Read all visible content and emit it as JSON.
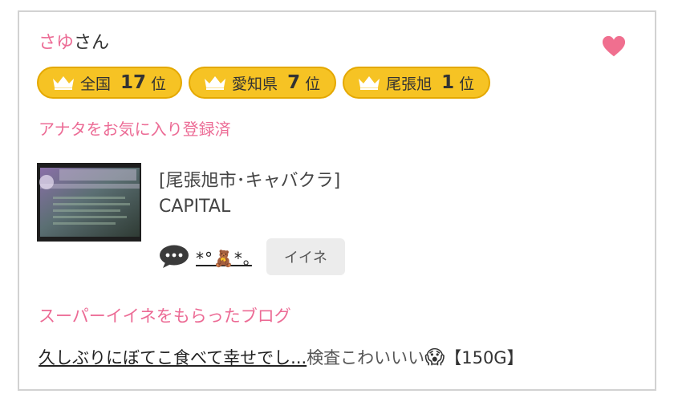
{
  "user": {
    "name_colored": "さゆ",
    "name_suffix": "さん"
  },
  "badges": [
    {
      "area": "全国",
      "rank": "17",
      "unit": "位"
    },
    {
      "area": "愛知県",
      "rank": "7",
      "unit": "位"
    },
    {
      "area": "尾張旭",
      "rank": "1",
      "unit": "位"
    }
  ],
  "favorite_note": "アナタをお気に入り登録済",
  "shop": {
    "category": "[尾張旭市･キャバクラ]",
    "name": "CAPITAL"
  },
  "comment": {
    "nickname": "*°🧸*｡",
    "iine_label": "イイネ"
  },
  "blog_section": {
    "title": "スーパーイイネをもらったブログ",
    "post_link": "久しぶりにぼてこ食べて幸せでし...",
    "post_rest": "検査こわいいい",
    "post_emoji": "😱",
    "points": "【150G】"
  },
  "colors": {
    "accent_pink": "#ec6b95",
    "badge_gold": "#f6c324",
    "heart": "#f06f8f"
  },
  "icons": {
    "heart": "heart-icon",
    "crown": "crown-icon",
    "comment": "speech-bubble-icon"
  }
}
